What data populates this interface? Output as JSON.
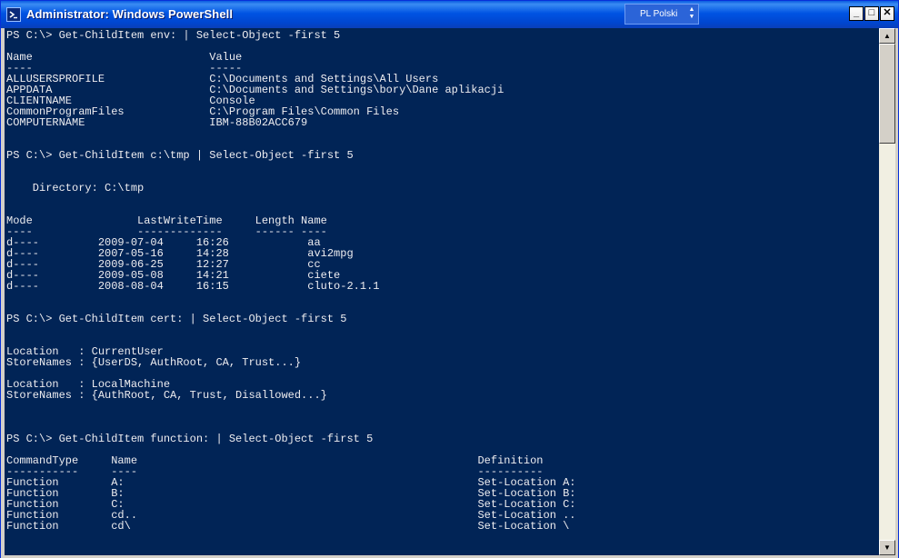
{
  "window": {
    "title": "Administrator: Windows PowerShell",
    "language_indicator": "PL Polski",
    "minimize_glyph": "_",
    "maximize_glyph": "□",
    "close_glyph": "✕"
  },
  "console_lines": [
    "PS C:\\> Get-ChildItem env: | Select-Object -first 5",
    "",
    "Name                           Value",
    "----                           -----",
    "ALLUSERSPROFILE                C:\\Documents and Settings\\All Users",
    "APPDATA                        C:\\Documents and Settings\\bory\\Dane aplikacji",
    "CLIENTNAME                     Console",
    "CommonProgramFiles             C:\\Program Files\\Common Files",
    "COMPUTERNAME                   IBM-88B02ACC679",
    "",
    "",
    "PS C:\\> Get-ChildItem c:\\tmp | Select-Object -first 5",
    "",
    "",
    "    Directory: C:\\tmp",
    "",
    "",
    "Mode                LastWriteTime     Length Name",
    "----                -------------     ------ ----",
    "d----         2009-07-04     16:26            aa",
    "d----         2007-05-16     14:28            avi2mpg",
    "d----         2009-06-25     12:27            cc",
    "d----         2009-05-08     14:21            ciete",
    "d----         2008-08-04     16:15            cluto-2.1.1",
    "",
    "",
    "PS C:\\> Get-ChildItem cert: | Select-Object -first 5",
    "",
    "",
    "Location   : CurrentUser",
    "StoreNames : {UserDS, AuthRoot, CA, Trust...}",
    "",
    "Location   : LocalMachine",
    "StoreNames : {AuthRoot, CA, Trust, Disallowed...}",
    "",
    "",
    "",
    "PS C:\\> Get-ChildItem function: | Select-Object -first 5",
    "",
    "CommandType     Name                                                    Definition",
    "-----------     ----                                                    ----------",
    "Function        A:                                                      Set-Location A:",
    "Function        B:                                                      Set-Location B:",
    "Function        C:                                                      Set-Location C:",
    "Function        cd..                                                    Set-Location ..",
    "Function        cd\\                                                     Set-Location \\"
  ],
  "scrollbar": {
    "up_arrow": "▲",
    "down_arrow": "▼",
    "position_fraction": 0.0
  },
  "colors": {
    "console_background": "#012456",
    "console_text": "#EEEDF0",
    "titlebar": "#0054E3"
  },
  "icons": {
    "app": "powershell-icon",
    "minimize": "minimize-icon",
    "maximize": "maximize-icon",
    "close": "close-icon"
  }
}
